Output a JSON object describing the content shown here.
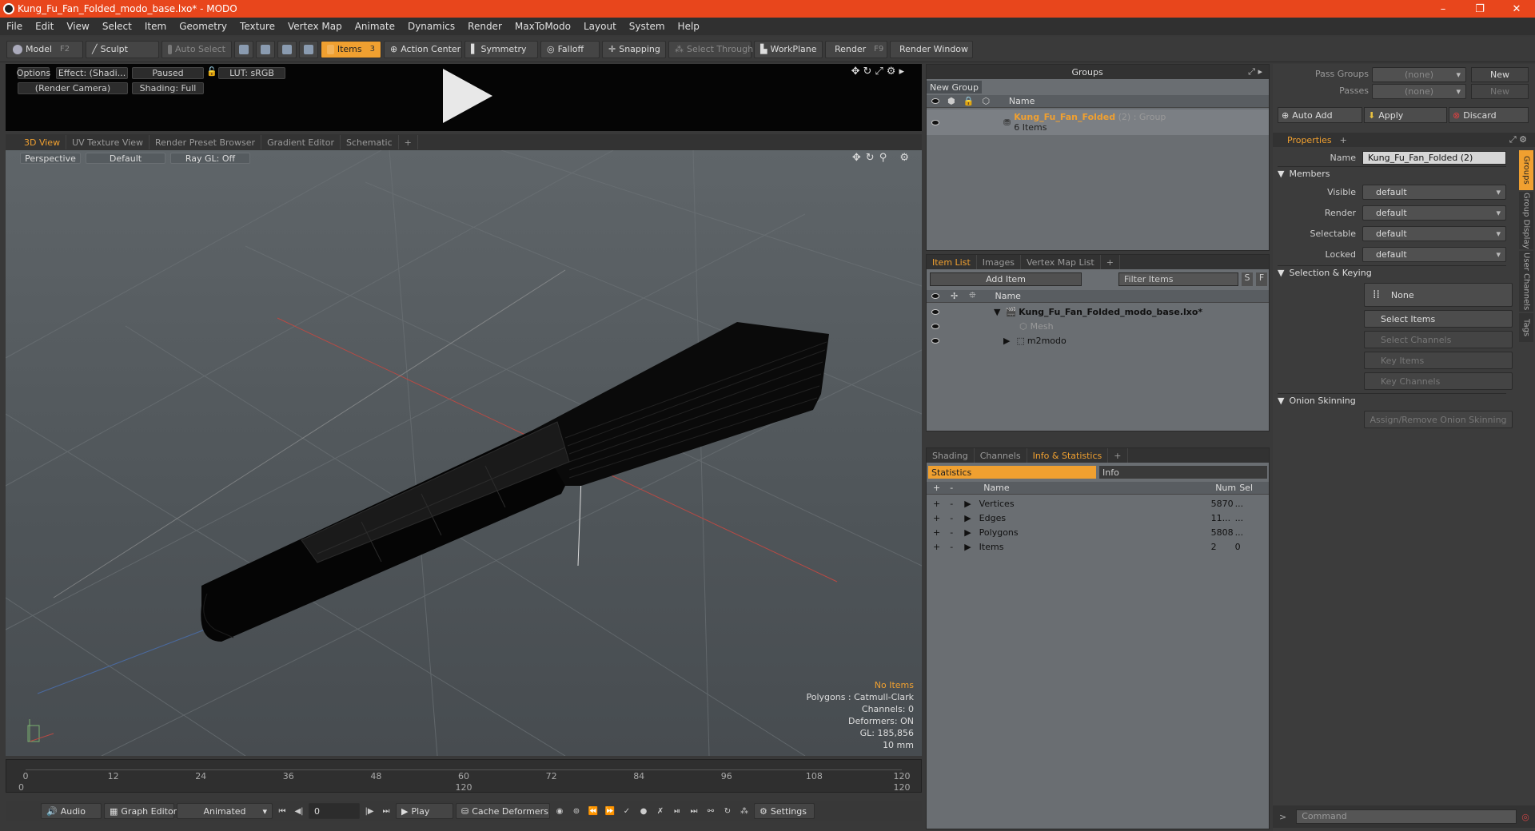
{
  "window": {
    "title": "Kung_Fu_Fan_Folded_modo_base.lxo* - MODO",
    "min": "–",
    "max": "❐",
    "close": "✕"
  },
  "menu": [
    "File",
    "Edit",
    "View",
    "Select",
    "Item",
    "Geometry",
    "Texture",
    "Vertex Map",
    "Animate",
    "Dynamics",
    "Render",
    "MaxToModo",
    "Layout",
    "System",
    "Help"
  ],
  "toolbar": {
    "model": "Model",
    "model_key": "F2",
    "sculpt": "Sculpt",
    "auto_select": "Auto Select",
    "items": "Items",
    "items_key": "3",
    "action_center": "Action Center",
    "symmetry": "Symmetry",
    "falloff": "Falloff",
    "snapping": "Snapping",
    "select_through": "Select Through",
    "workplane": "WorkPlane",
    "render": "Render",
    "render_key": "F9",
    "render_window": "Render Window"
  },
  "preview": {
    "options": "Options",
    "effect": "Effect: (Shadi...",
    "paused": "Paused",
    "lut": "LUT: sRGB",
    "camera": "(Render Camera)",
    "shading": "Shading: Full"
  },
  "view_tabs": [
    "3D View",
    "UV Texture View",
    "Render Preset Browser",
    "Gradient Editor",
    "Schematic",
    "+"
  ],
  "viewport": {
    "projection": "Perspective",
    "style": "Default",
    "raygl": "Ray GL: Off",
    "overlay": {
      "selection": "No Items",
      "polygons": "Polygons : Catmull-Clark",
      "channels": "Channels: 0",
      "deformers": "Deformers: ON",
      "gl": "GL: 185,856",
      "scale": "10 mm"
    }
  },
  "timeline": {
    "top_ticks": [
      "0",
      "12",
      "24",
      "36",
      "48",
      "60",
      "72",
      "84",
      "96",
      "108",
      "120"
    ],
    "bottom_ticks": [
      "0",
      "120",
      "120"
    ]
  },
  "playback": {
    "audio": "Audio",
    "graph_editor": "Graph Editor",
    "animated": "Animated",
    "frame": "0",
    "play": "Play",
    "cache_deformers": "Cache Deformers",
    "settings": "Settings"
  },
  "groups": {
    "title": "Groups",
    "new_group": "New Group",
    "col_name": "Name",
    "row_name": "Kung_Fu_Fan_Folded",
    "row_suffix": "(2) : Group",
    "row_sub": "6 Items"
  },
  "itemlist": {
    "tabs": [
      "Item List",
      "Images",
      "Vertex Map List",
      "+"
    ],
    "add_item": "Add Item",
    "filter": "Filter Items",
    "s": "S",
    "f": "F",
    "col_name": "Name",
    "rows": [
      {
        "label": "Kung_Fu_Fan_Folded_modo_base.lxo*"
      },
      {
        "label": "Mesh"
      },
      {
        "label": "m2modo"
      }
    ]
  },
  "stats": {
    "tabs": [
      "Shading",
      "Channels",
      "Info & Statistics",
      "+"
    ],
    "sub_tabs": [
      "Statistics",
      "Info"
    ],
    "cols": [
      "Name",
      "Num",
      "Sel"
    ],
    "rows": [
      {
        "name": "Vertices",
        "num": "5870",
        "sel": "..."
      },
      {
        "name": "Edges",
        "num": "11...",
        "sel": "..."
      },
      {
        "name": "Polygons",
        "num": "5808",
        "sel": "..."
      },
      {
        "name": "Items",
        "num": "2",
        "sel": "0"
      }
    ]
  },
  "right": {
    "pass_groups": "Pass Groups",
    "pass_groups_val": "(none)",
    "passes": "Passes",
    "passes_val": "(none)",
    "new": "New",
    "new2": "New",
    "auto_add": "Auto Add",
    "apply": "Apply",
    "discard": "Discard",
    "properties": "Properties",
    "name_lbl": "Name",
    "name_val": "Kung_Fu_Fan_Folded (2)",
    "members": "Members",
    "visible": "Visible",
    "render": "Render",
    "selectable": "Selectable",
    "locked": "Locked",
    "dd_val": "default",
    "sel_keying": "Selection & Keying",
    "none": "None",
    "select_items": "Select Items",
    "select_channels": "Select Channels",
    "key_items": "Key Items",
    "key_channels": "Key Channels",
    "onion": "Onion Skinning",
    "assign_onion": "Assign/Remove Onion Skinning",
    "vtabs": [
      "Groups",
      "Group Display",
      "User Channels",
      "Tags"
    ],
    "command": "Command"
  },
  "colors": {
    "accent": "#f0a030",
    "titlebar": "#e8461c"
  }
}
